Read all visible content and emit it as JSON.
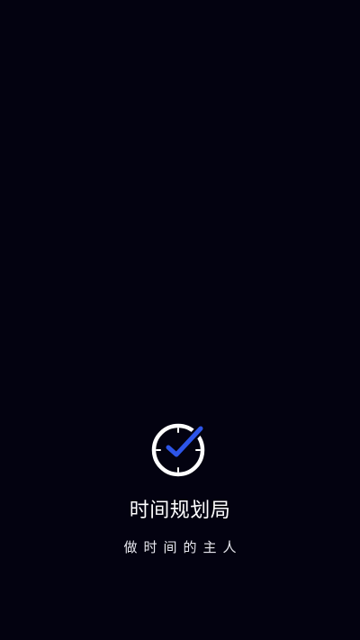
{
  "splash": {
    "logo_icon": "clock-check-icon",
    "app_name": "时间规划局",
    "slogan": "做时间的主人"
  },
  "colors": {
    "background": "#030210",
    "logo_ring": "#ffffff",
    "check_accent": "#2d55e8",
    "text_primary": "#ffffff"
  }
}
